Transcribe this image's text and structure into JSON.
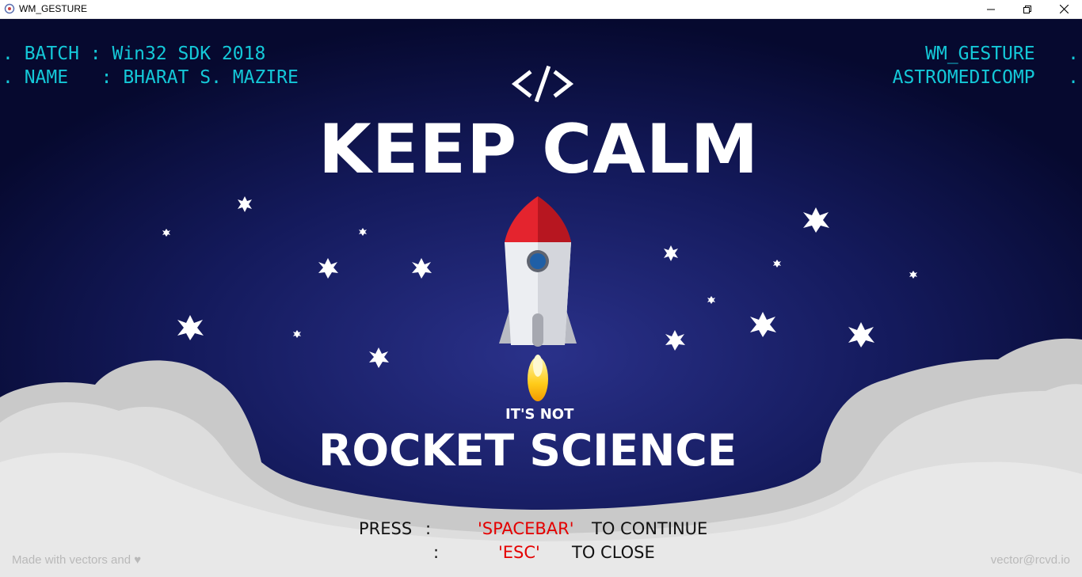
{
  "window": {
    "title": "WM_GESTURE"
  },
  "top_left": {
    "batch_line": ". BATCH : Win32 SDK 2018",
    "name_line": ". NAME   : BHARAT S. MAZIRE"
  },
  "top_right": {
    "line1": "WM_GESTURE   .",
    "line2": "ASTROMEDICOMP   ."
  },
  "poster": {
    "code_tag": "</>",
    "headline": "KEEP CALM",
    "subline": "IT'S NOT",
    "tagline": "ROCKET SCIENCE",
    "footer_left": "Made with vectors and ♥",
    "footer_right": "vector@rcvd.io"
  },
  "instructions": {
    "press": "PRESS",
    "colon1": ":",
    "key1": "'SPACEBAR'",
    "action1": "TO CONTINUE",
    "colon2": ":",
    "key2": "'ESC'",
    "action2": "TO CLOSE"
  },
  "colors": {
    "background": "#080c3a",
    "cyan_text": "#14c8d8",
    "key_red": "#e40000",
    "cloud": "#e6e6e6"
  }
}
